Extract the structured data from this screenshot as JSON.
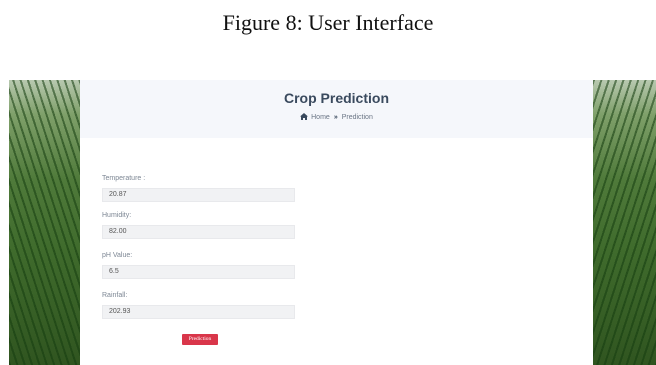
{
  "figure_caption": "Figure 8: User Interface",
  "header": {
    "title": "Crop Prediction",
    "breadcrumb": {
      "home": "Home",
      "separator": "»",
      "current": "Prediction"
    }
  },
  "form": {
    "fields": [
      {
        "label": "Temperature :",
        "value": "20.87"
      },
      {
        "label": "Humidity:",
        "value": "82.00"
      },
      {
        "label": "pH Value:",
        "value": "6.5"
      },
      {
        "label": "Rainfall:",
        "value": "202.93"
      }
    ],
    "submit_label": "Prediction"
  },
  "colors": {
    "header_bg": "#f5f7fb",
    "button": "#d9364a",
    "title": "#3a4a5e"
  }
}
